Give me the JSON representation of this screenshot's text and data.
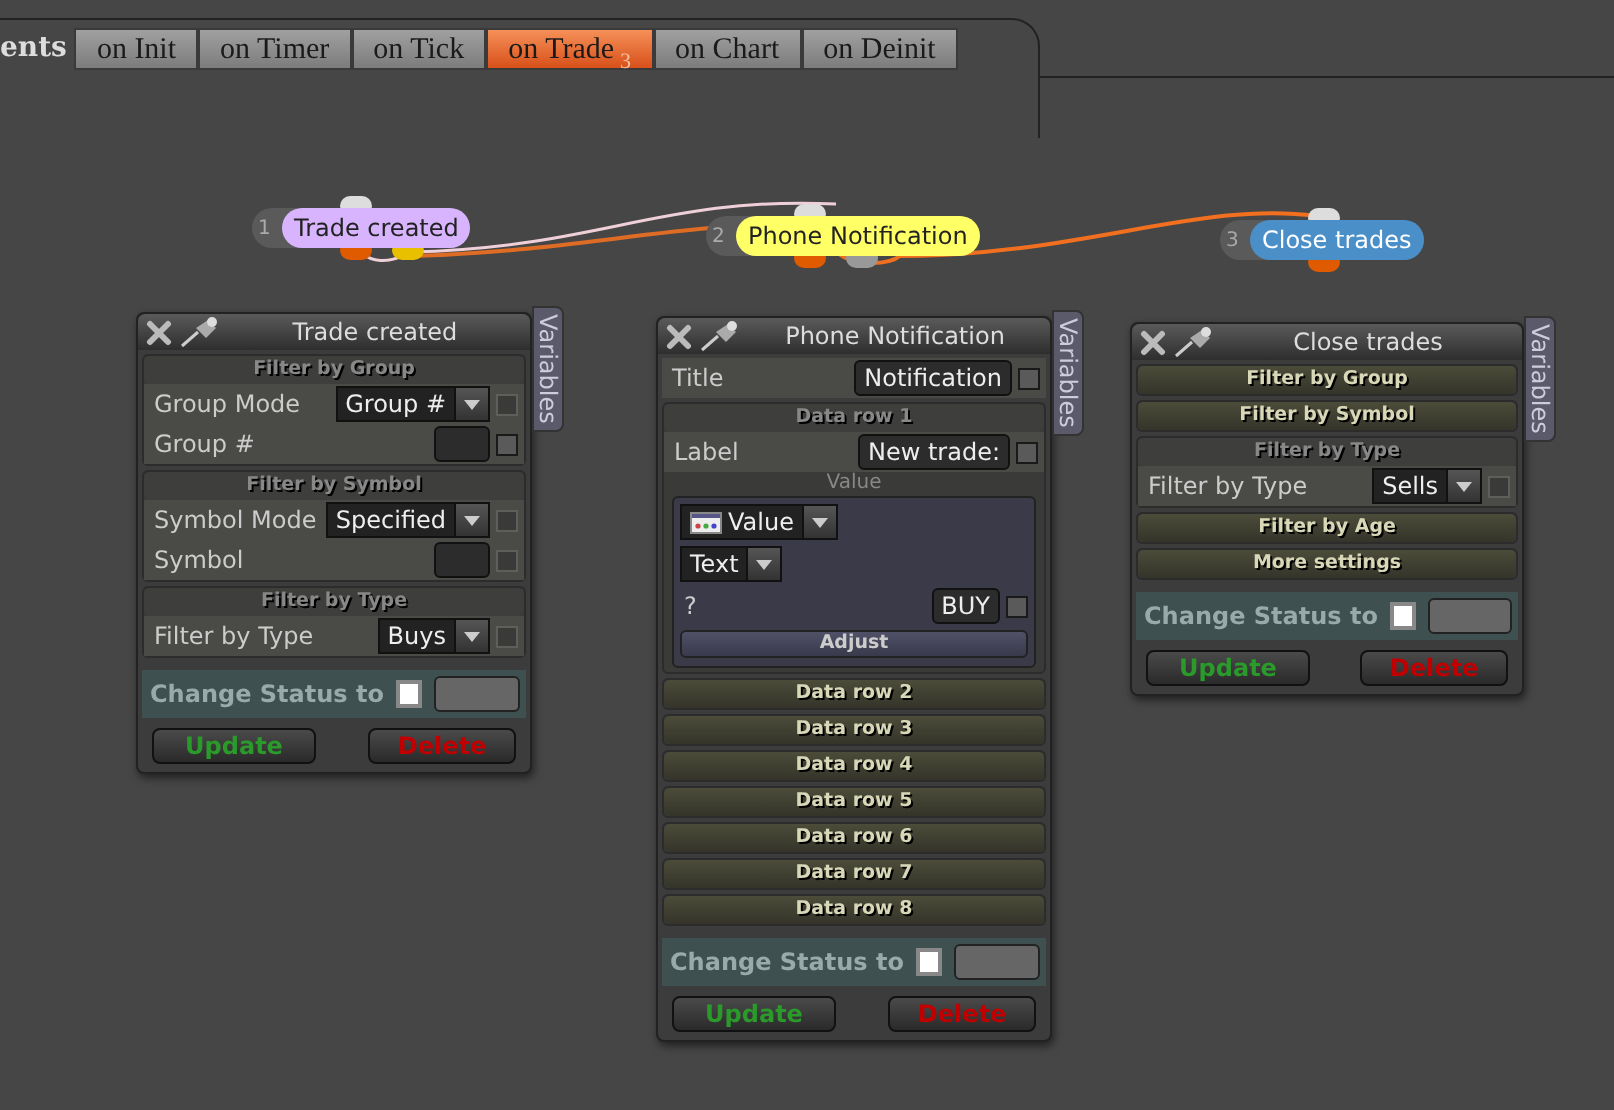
{
  "tabs_prefix": "ents",
  "tabs": [
    {
      "label": "on Init",
      "selected": false
    },
    {
      "label": "on Timer",
      "selected": false
    },
    {
      "label": "on Tick",
      "selected": false
    },
    {
      "label": "on Trade",
      "selected": true,
      "badge": "3"
    },
    {
      "label": "on Chart",
      "selected": false
    },
    {
      "label": "on Deinit",
      "selected": false
    }
  ],
  "nodes": [
    {
      "number": "1",
      "label": "Trade created",
      "color": "#d8b4fe"
    },
    {
      "number": "2",
      "label": "Phone Notification",
      "color": "#ffff66"
    },
    {
      "number": "3",
      "label": "Close trades",
      "color": "#4a8fc8"
    }
  ],
  "panels": [
    {
      "title": "Trade created",
      "side_tab": "Variables",
      "items": [
        {
          "kind": "group",
          "title": "Filter by Group",
          "expanded": true,
          "rows": [
            {
              "kind": "select",
              "label": "Group Mode",
              "value": "Group #",
              "checked": false,
              "disabled": true
            },
            {
              "kind": "field",
              "label": "Group #",
              "checked": false,
              "disabled": false
            }
          ]
        },
        {
          "kind": "group",
          "title": "Filter by Symbol",
          "expanded": true,
          "rows": [
            {
              "kind": "select",
              "label": "Symbol Mode",
              "value": "Specified",
              "checked": false,
              "disabled": true
            },
            {
              "kind": "field",
              "label": "Symbol",
              "checked": false,
              "disabled": true
            }
          ]
        },
        {
          "kind": "group",
          "title": "Filter by Type",
          "expanded": true,
          "rows": [
            {
              "kind": "select",
              "label": "Filter by Type",
              "value": "Buys",
              "checked": false,
              "disabled": true
            }
          ]
        }
      ],
      "status": {
        "label": "Change Status to",
        "checked": false
      },
      "buttons": [
        "Update",
        "Delete"
      ]
    },
    {
      "title": "Phone Notification",
      "side_tab": "Variables",
      "items": [
        {
          "kind": "row",
          "row": {
            "kind": "field",
            "label": "Title",
            "value": "Notification",
            "checked": false,
            "disabled": false
          }
        },
        {
          "kind": "group",
          "title": "Data row 1",
          "expanded": true,
          "rows": [
            {
              "kind": "field",
              "label": "Label",
              "value": "New trade:",
              "checked": false,
              "disabled": false
            },
            {
              "kind": "caption",
              "label": "Value"
            },
            {
              "kind": "editor",
              "rows": [
                {
                  "kind": "select",
                  "value": "Value",
                  "icon": true
                },
                {
                  "kind": "select",
                  "value": "Text",
                  "icon": false
                },
                {
                  "kind": "field",
                  "label": "?",
                  "value": "BUY",
                  "checked": false,
                  "disabled": false
                },
                {
                  "kind": "button",
                  "label": "Adjust"
                }
              ]
            }
          ]
        },
        {
          "kind": "group",
          "title": "Data row 2",
          "expanded": false
        },
        {
          "kind": "group",
          "title": "Data row 3",
          "expanded": false
        },
        {
          "kind": "group",
          "title": "Data row 4",
          "expanded": false
        },
        {
          "kind": "group",
          "title": "Data row 5",
          "expanded": false
        },
        {
          "kind": "group",
          "title": "Data row 6",
          "expanded": false
        },
        {
          "kind": "group",
          "title": "Data row 7",
          "expanded": false
        },
        {
          "kind": "group",
          "title": "Data row 8",
          "expanded": false
        }
      ],
      "status": {
        "label": "Change Status to",
        "checked": false
      },
      "buttons": [
        "Update",
        "Delete"
      ]
    },
    {
      "title": "Close trades",
      "side_tab": "Variables",
      "items": [
        {
          "kind": "group",
          "title": "Filter by Group",
          "expanded": false
        },
        {
          "kind": "group",
          "title": "Filter by Symbol",
          "expanded": false
        },
        {
          "kind": "group",
          "title": "Filter by Type",
          "expanded": true,
          "rows": [
            {
              "kind": "select",
              "label": "Filter by Type",
              "value": "Sells",
              "checked": false,
              "disabled": true
            }
          ]
        },
        {
          "kind": "group",
          "title": "Filter by Age",
          "expanded": false
        },
        {
          "kind": "group",
          "title": "More settings",
          "expanded": false
        }
      ],
      "status": {
        "label": "Change Status to",
        "checked": false
      },
      "buttons": [
        "Update",
        "Delete"
      ]
    }
  ]
}
